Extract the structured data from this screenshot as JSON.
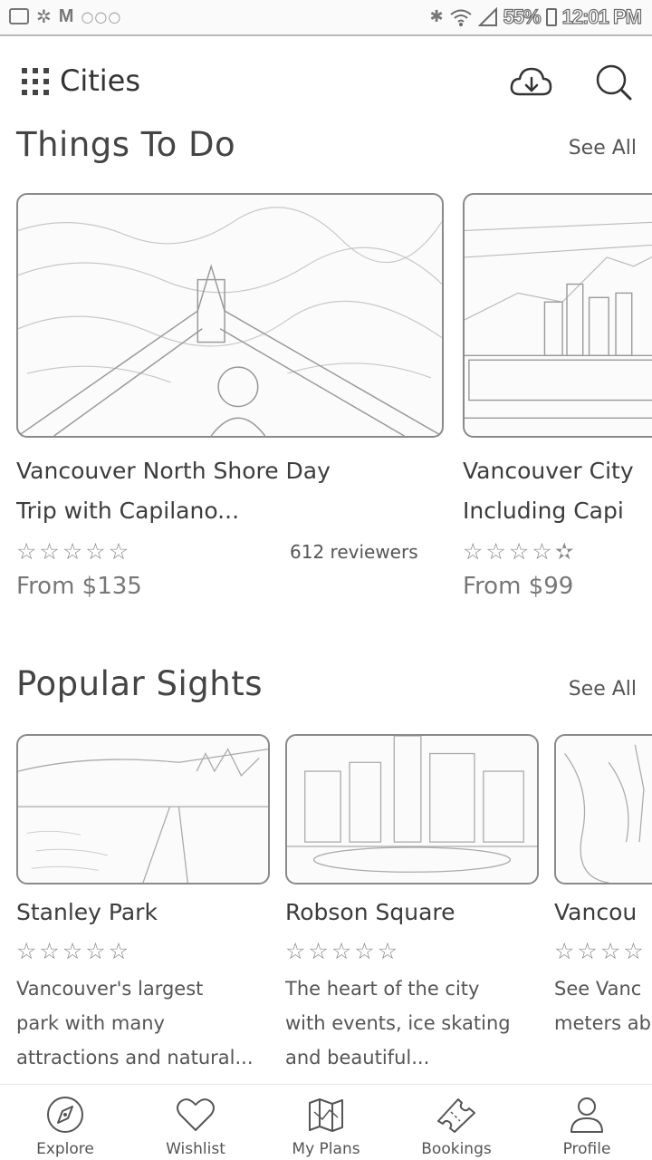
{
  "status_bar": {
    "battery": "55%",
    "time": "12:01 PM"
  },
  "header": {
    "title": "Cities",
    "icons": [
      "grid-menu-icon",
      "cloud-download-icon",
      "search-icon"
    ]
  },
  "things_to_do": {
    "title": "Things To Do",
    "see_all": "See All",
    "cards": [
      {
        "title_line1": "Vancouver North Shore Day",
        "title_line2": "Trip with Capilano...",
        "rating": 5,
        "reviewers": "612 reviewers",
        "price": "From $135"
      },
      {
        "title_line1": "Vancouver City",
        "title_line2": "Including Capi",
        "rating": 4.5,
        "price": "From $99"
      }
    ]
  },
  "popular_sights": {
    "title": "Popular Sights",
    "see_all": "See All",
    "cards": [
      {
        "title": "Stanley Park",
        "rating": 5,
        "desc_line1": "Vancouver's largest",
        "desc_line2": "park with many",
        "desc_line3": "attractions and natural..."
      },
      {
        "title": "Robson Square",
        "rating": 5,
        "desc_line1": "The heart of the city",
        "desc_line2": "with events, ice skating",
        "desc_line3": "and beautiful..."
      },
      {
        "title": "Vancou",
        "rating": 5,
        "desc_line1": "See Vanc",
        "desc_line2": "meters ab"
      }
    ]
  },
  "bottom_nav": {
    "items": [
      {
        "label": "Explore",
        "icon": "compass-icon"
      },
      {
        "label": "Wishlist",
        "icon": "heart-icon"
      },
      {
        "label": "My Plans",
        "icon": "map-icon"
      },
      {
        "label": "Bookings",
        "icon": "ticket-icon"
      },
      {
        "label": "Profile",
        "icon": "person-icon"
      }
    ]
  }
}
